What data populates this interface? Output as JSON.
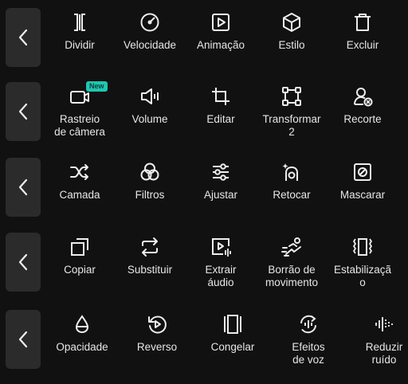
{
  "rows": [
    {
      "tools": [
        {
          "label": "Dividir",
          "icon": "split-icon"
        },
        {
          "label": "Velocidade",
          "icon": "speed-icon"
        },
        {
          "label": "Animação",
          "icon": "animation-icon"
        },
        {
          "label": "Estilo",
          "icon": "style-cube-icon"
        },
        {
          "label": "Excluir",
          "icon": "trash-icon"
        }
      ]
    },
    {
      "tools": [
        {
          "label": "Rastreio\nde câmera",
          "icon": "camera-tracking-icon",
          "badge": "New"
        },
        {
          "label": "Volume",
          "icon": "volume-icon"
        },
        {
          "label": "Editar",
          "icon": "crop-icon"
        },
        {
          "label": "Transformar\n2",
          "icon": "transform-icon"
        },
        {
          "label": "Recorte",
          "icon": "cutout-person-icon"
        }
      ]
    },
    {
      "tools": [
        {
          "label": "Camada",
          "icon": "layer-shuffle-icon"
        },
        {
          "label": "Filtros",
          "icon": "filters-icon"
        },
        {
          "label": "Ajustar",
          "icon": "adjust-sliders-icon"
        },
        {
          "label": "Retocar",
          "icon": "retouch-icon"
        },
        {
          "label": "Mascarar",
          "icon": "mask-icon"
        }
      ]
    },
    {
      "tools": [
        {
          "label": "Copiar",
          "icon": "copy-icon"
        },
        {
          "label": "Substituir",
          "icon": "replace-icon"
        },
        {
          "label": "Extrair\náudio",
          "icon": "extract-audio-icon"
        },
        {
          "label": "Borrão de\nmovimento",
          "icon": "motion-blur-icon"
        },
        {
          "label": "Estabilizaçã\no",
          "icon": "stabilize-icon"
        }
      ]
    },
    {
      "tools": [
        {
          "label": "Opacidade",
          "icon": "opacity-drop-icon"
        },
        {
          "label": "Reverso",
          "icon": "reverse-icon"
        },
        {
          "label": "Congelar",
          "icon": "freeze-icon"
        },
        {
          "label": "Efeitos\nde voz",
          "icon": "voice-effects-icon"
        },
        {
          "label": "Reduzir\nruído",
          "icon": "noise-reduction-icon"
        }
      ]
    }
  ],
  "colors": {
    "background": "#111111",
    "back_button": "#2b2b2b",
    "icon": "#eeeeee",
    "badge": "#1fc6b1"
  }
}
